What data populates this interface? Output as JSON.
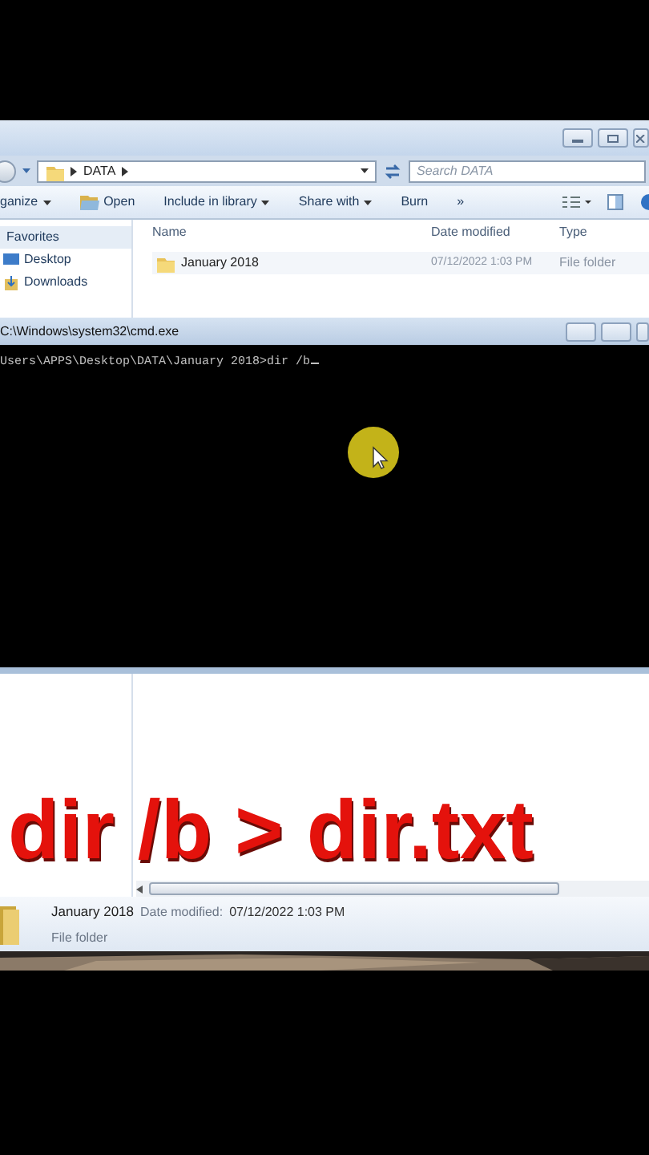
{
  "explorer": {
    "path": "DATA",
    "search_placeholder": "Search DATA",
    "toolbar": [
      {
        "label": "ganize",
        "kind": "menu"
      },
      {
        "label": "Open",
        "kind": "open"
      },
      {
        "label": "Include in library",
        "kind": "menu"
      },
      {
        "label": "Share with",
        "kind": "menu"
      },
      {
        "label": "Burn",
        "kind": "plain"
      },
      {
        "label": "»",
        "kind": "plain"
      }
    ],
    "sidebar": [
      {
        "label": "Favorites",
        "kind": "header"
      },
      {
        "label": "Desktop",
        "kind": "desktop"
      },
      {
        "label": "Downloads",
        "kind": "downloads"
      }
    ],
    "columns": [
      "Name",
      "Date modified",
      "Type"
    ],
    "rows": [
      {
        "name": "January 2018",
        "date": "07/12/2022 1:03 PM",
        "type": "File folder"
      }
    ]
  },
  "cmd": {
    "title": "C:\\Windows\\system32\\cmd.exe",
    "line": "Users\\APPS\\Desktop\\DATA\\January 2018>dir /b"
  },
  "caption": "dir /b > dir.txt",
  "details": {
    "name": "January 2018",
    "date_label": "Date modified:",
    "date": "07/12/2022 1:03 PM",
    "type": "File folder"
  }
}
